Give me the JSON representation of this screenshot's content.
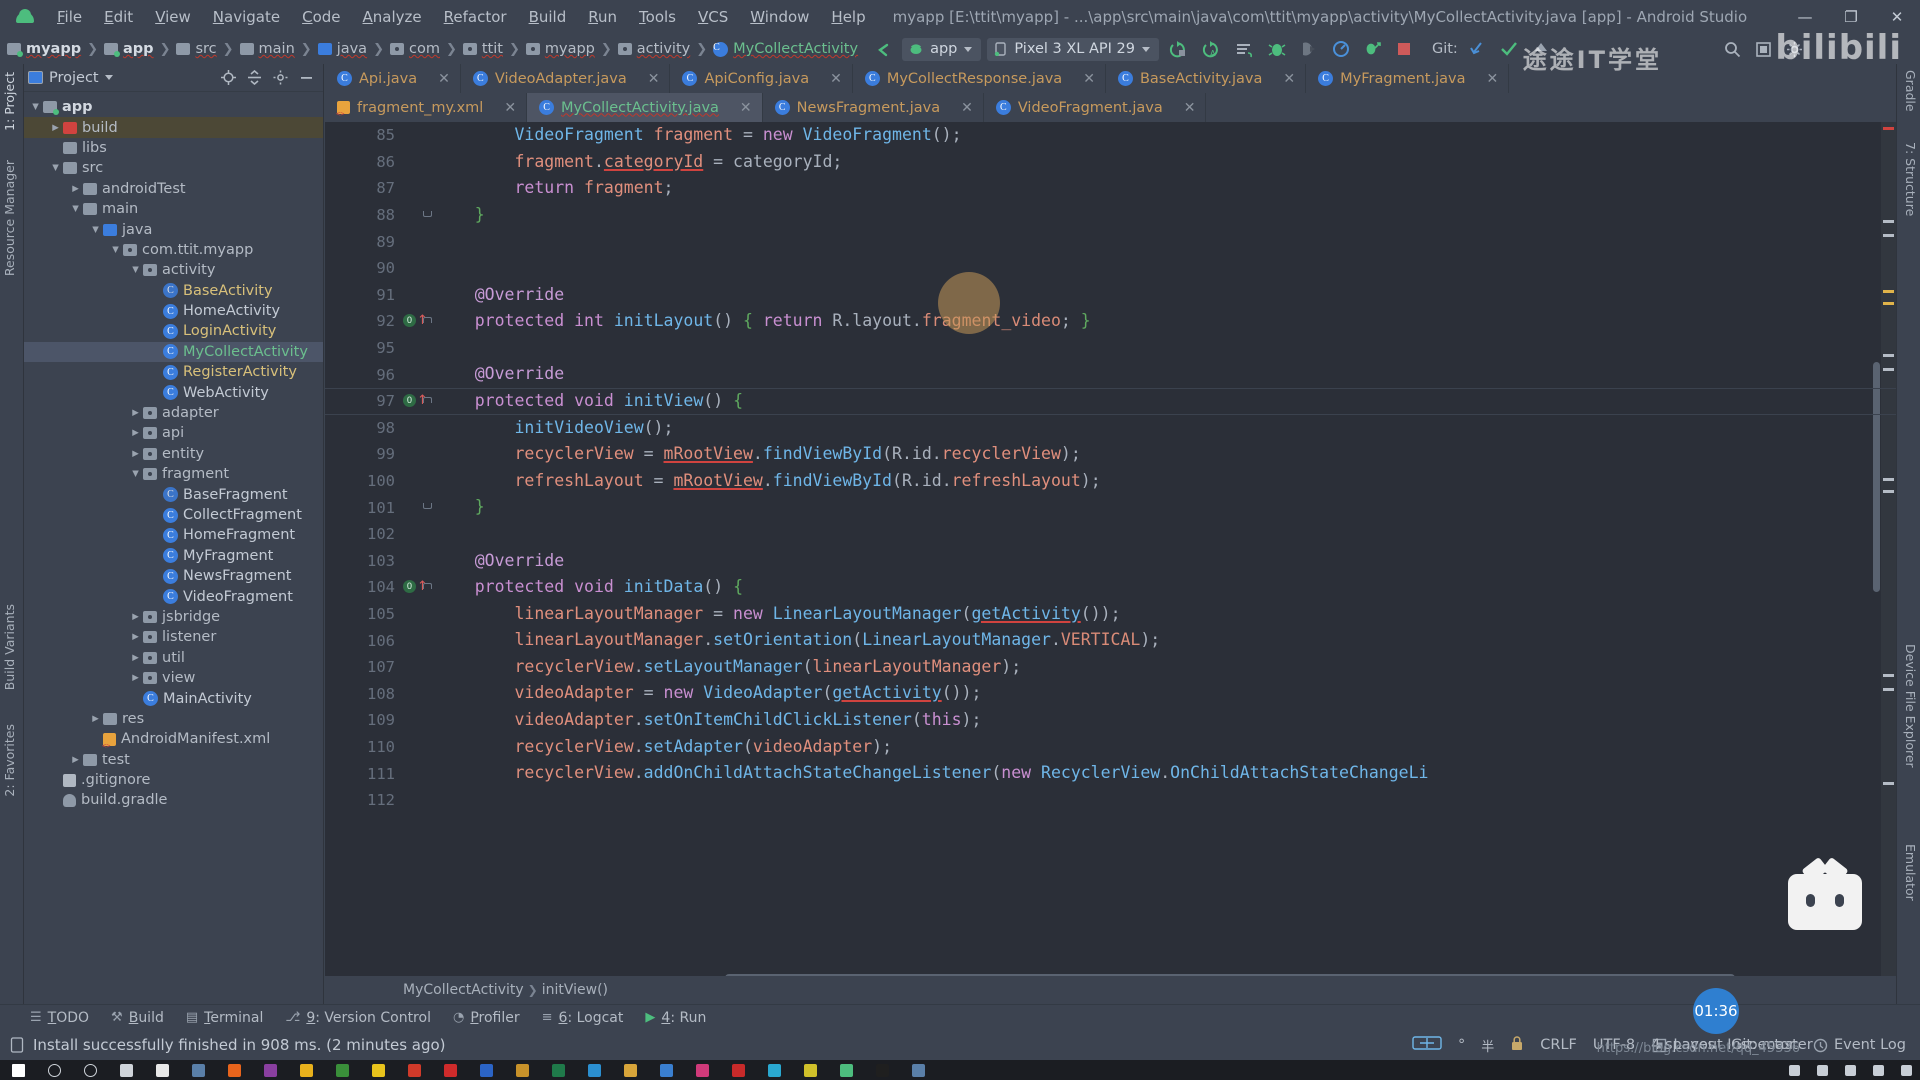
{
  "window": {
    "title": "myapp [E:\\ttit\\myapp] - ...\\app\\src\\main\\java\\com\\ttit\\myapp\\activity\\MyCollectActivity.java [app] - Android Studio",
    "minimize": "—",
    "maximize": "❐",
    "close": "✕"
  },
  "menu": [
    {
      "label": "File"
    },
    {
      "label": "Edit"
    },
    {
      "label": "View"
    },
    {
      "label": "Navigate"
    },
    {
      "label": "Code"
    },
    {
      "label": "Analyze"
    },
    {
      "label": "Refactor"
    },
    {
      "label": "Build"
    },
    {
      "label": "Run"
    },
    {
      "label": "Tools"
    },
    {
      "label": "VCS"
    },
    {
      "label": "Window"
    },
    {
      "label": "Help"
    }
  ],
  "breadcrumb": [
    {
      "label": "myapp",
      "icon": "module-icon",
      "bold": true
    },
    {
      "label": "app",
      "icon": "module-icon",
      "bold": true
    },
    {
      "label": "src",
      "icon": "folder-icon"
    },
    {
      "label": "main",
      "icon": "folder-icon"
    },
    {
      "label": "java",
      "icon": "source-folder-icon"
    },
    {
      "label": "com",
      "icon": "package-icon"
    },
    {
      "label": "ttit",
      "icon": "package-icon"
    },
    {
      "label": "myapp",
      "icon": "package-icon"
    },
    {
      "label": "activity",
      "icon": "package-icon"
    },
    {
      "label": "MyCollectActivity",
      "icon": "class-icon",
      "green": true
    }
  ],
  "toolbar": {
    "module_selector": "app",
    "device_selector": "Pixel 3 XL API 29",
    "git_label": "Git:",
    "icons": [
      "run-icon",
      "run-with-coverage-icon",
      "apply-changes-icon",
      "debug-icon",
      "attach-debugger-icon",
      "profiler-icon",
      "apply-code-changes-icon",
      "stop-icon"
    ],
    "git_icons": [
      "update-project-icon",
      "commit-icon",
      "push-icon"
    ],
    "right_icons": [
      "search-everywhere-icon",
      "settings-icon",
      "layout-inspector-icon"
    ]
  },
  "left_stripe": [
    {
      "label": "1: Project",
      "selected": true
    },
    {
      "label": "Resource Manager"
    },
    {
      "label": "Build Variants"
    },
    {
      "label": "2: Favorites"
    }
  ],
  "right_stripe": [
    {
      "label": "Gradle"
    },
    {
      "label": "7: Structure"
    },
    {
      "label": "Device File Explorer"
    },
    {
      "label": "Emulator"
    }
  ],
  "project_panel": {
    "title": "Project",
    "actions": [
      "locate-icon",
      "collapse-all-icon",
      "settings-icon",
      "hide-icon"
    ],
    "tree": [
      {
        "label": "app",
        "depth": 0,
        "arrow": "down",
        "icon": "module-icon",
        "style": "bold"
      },
      {
        "label": "build",
        "depth": 1,
        "arrow": "right",
        "icon": "folder-red-icon",
        "select": "dim"
      },
      {
        "label": "libs",
        "depth": 1,
        "arrow": "none",
        "icon": "folder-icon"
      },
      {
        "label": "src",
        "depth": 1,
        "arrow": "down",
        "icon": "folder-icon"
      },
      {
        "label": "androidTest",
        "depth": 2,
        "arrow": "right",
        "icon": "folder-icon"
      },
      {
        "label": "main",
        "depth": 2,
        "arrow": "down",
        "icon": "folder-icon"
      },
      {
        "label": "java",
        "depth": 3,
        "arrow": "down",
        "icon": "source-folder-icon"
      },
      {
        "label": "com.ttit.myapp",
        "depth": 4,
        "arrow": "down",
        "icon": "package-icon"
      },
      {
        "label": "activity",
        "depth": 5,
        "arrow": "down",
        "icon": "package-icon"
      },
      {
        "label": "BaseActivity",
        "depth": 6,
        "arrow": "none",
        "icon": "abstract-class-icon",
        "style": "yellow"
      },
      {
        "label": "HomeActivity",
        "depth": 6,
        "arrow": "none",
        "icon": "class-icon",
        "style": "white"
      },
      {
        "label": "LoginActivity",
        "depth": 6,
        "arrow": "none",
        "icon": "class-icon",
        "style": "yellow"
      },
      {
        "label": "MyCollectActivity",
        "depth": 6,
        "arrow": "none",
        "icon": "class-icon",
        "style": "green",
        "select": "blue"
      },
      {
        "label": "RegisterActivity",
        "depth": 6,
        "arrow": "none",
        "icon": "class-icon",
        "style": "yellow"
      },
      {
        "label": "WebActivity",
        "depth": 6,
        "arrow": "none",
        "icon": "class-icon",
        "style": "white"
      },
      {
        "label": "adapter",
        "depth": 5,
        "arrow": "right",
        "icon": "package-icon"
      },
      {
        "label": "api",
        "depth": 5,
        "arrow": "right",
        "icon": "package-icon"
      },
      {
        "label": "entity",
        "depth": 5,
        "arrow": "right",
        "icon": "package-icon"
      },
      {
        "label": "fragment",
        "depth": 5,
        "arrow": "down",
        "icon": "package-icon"
      },
      {
        "label": "BaseFragment",
        "depth": 6,
        "arrow": "none",
        "icon": "abstract-class-icon",
        "style": "white"
      },
      {
        "label": "CollectFragment",
        "depth": 6,
        "arrow": "none",
        "icon": "class-icon",
        "style": "white"
      },
      {
        "label": "HomeFragment",
        "depth": 6,
        "arrow": "none",
        "icon": "class-icon",
        "style": "white"
      },
      {
        "label": "MyFragment",
        "depth": 6,
        "arrow": "none",
        "icon": "class-icon",
        "style": "white"
      },
      {
        "label": "NewsFragment",
        "depth": 6,
        "arrow": "none",
        "icon": "class-icon",
        "style": "white"
      },
      {
        "label": "VideoFragment",
        "depth": 6,
        "arrow": "none",
        "icon": "class-icon",
        "style": "white"
      },
      {
        "label": "jsbridge",
        "depth": 5,
        "arrow": "right",
        "icon": "package-icon"
      },
      {
        "label": "listener",
        "depth": 5,
        "arrow": "right",
        "icon": "package-icon"
      },
      {
        "label": "util",
        "depth": 5,
        "arrow": "right",
        "icon": "package-icon"
      },
      {
        "label": "view",
        "depth": 5,
        "arrow": "right",
        "icon": "package-icon"
      },
      {
        "label": "MainActivity",
        "depth": 5,
        "arrow": "none",
        "icon": "class-icon",
        "style": "white"
      },
      {
        "label": "res",
        "depth": 3,
        "arrow": "right",
        "icon": "folder-icon"
      },
      {
        "label": "AndroidManifest.xml",
        "depth": 3,
        "arrow": "none",
        "icon": "xml-icon"
      },
      {
        "label": "test",
        "depth": 2,
        "arrow": "right",
        "icon": "folder-icon"
      },
      {
        "label": ".gitignore",
        "depth": 1,
        "arrow": "none",
        "icon": "git-icon"
      },
      {
        "label": "build.gradle",
        "depth": 1,
        "arrow": "none",
        "icon": "gradle-icon"
      }
    ]
  },
  "editor": {
    "tabs_row1": [
      {
        "label": "Api.java",
        "icon": "class-icon",
        "active": false
      },
      {
        "label": "VideoAdapter.java",
        "icon": "class-icon",
        "active": false
      },
      {
        "label": "ApiConfig.java",
        "icon": "class-icon",
        "active": false
      },
      {
        "label": "MyCollectResponse.java",
        "icon": "class-icon",
        "active": false
      },
      {
        "label": "BaseActivity.java",
        "icon": "class-icon",
        "active": false
      },
      {
        "label": "MyFragment.java",
        "icon": "class-icon",
        "active": false
      }
    ],
    "tabs_row2": [
      {
        "label": "fragment_my.xml",
        "icon": "xml-icon",
        "active": false
      },
      {
        "label": "MyCollectActivity.java",
        "icon": "class-icon",
        "active": true
      },
      {
        "label": "NewsFragment.java",
        "icon": "class-icon",
        "active": false
      },
      {
        "label": "VideoFragment.java",
        "icon": "class-icon",
        "active": false
      }
    ],
    "close_glyph": "✕",
    "first_line_number": 85,
    "line_numbers": [
      85,
      86,
      87,
      88,
      89,
      90,
      91,
      92,
      95,
      96,
      97,
      98,
      99,
      100,
      101,
      102,
      103,
      104,
      105,
      106,
      107,
      108,
      109,
      110,
      111,
      112
    ],
    "code_lines": [
      "        VideoFragment fragment = new VideoFragment();",
      "        fragment.categoryId = categoryId;",
      "        return fragment;",
      "    }",
      "",
      "",
      "    @Override",
      "    protected int initLayout() { return R.layout.fragment_video; }",
      "",
      "    @Override",
      "    protected void initView() {",
      "        initVideoView();",
      "        recyclerView = mRootView.findViewById(R.id.recyclerView);",
      "        refreshLayout = mRootView.findViewById(R.id.refreshLayout);",
      "    }",
      "",
      "    @Override",
      "    protected void initData() {",
      "        linearLayoutManager = new LinearLayoutManager(getActivity());",
      "        linearLayoutManager.setOrientation(LinearLayoutManager.VERTICAL);",
      "        recyclerView.setLayoutManager(linearLayoutManager);",
      "        videoAdapter = new VideoAdapter(getActivity());",
      "        videoAdapter.setOnItemChildClickListener(this);",
      "        recyclerView.setAdapter(videoAdapter);",
      "        recyclerView.addOnChildAttachStateChangeListener(new RecyclerView.OnChildAttachStateChangeLi",
      "        "
    ],
    "gutter_markers": [
      {
        "line": 92,
        "type": "override-marker"
      },
      {
        "line": 97,
        "type": "override-marker"
      },
      {
        "line": 104,
        "type": "override-marker"
      }
    ],
    "breadcrumbs": [
      {
        "label": "MyCollectActivity"
      },
      {
        "label": "initView()"
      }
    ]
  },
  "bottom_tools": [
    {
      "label": "TODO",
      "shortcut": "",
      "icon": "todo-icon"
    },
    {
      "label": "Build",
      "shortcut": "",
      "icon": "build-icon"
    },
    {
      "label": "Terminal",
      "shortcut": "",
      "icon": "terminal-icon"
    },
    {
      "label": "9: Version Control",
      "shortcut": "9",
      "icon": "vcs-icon"
    },
    {
      "label": "Profiler",
      "shortcut": "",
      "icon": "profiler-icon"
    },
    {
      "label": "6: Logcat",
      "shortcut": "6",
      "icon": "logcat-icon"
    },
    {
      "label": "4: Run",
      "shortcut": "4",
      "icon": "run-icon"
    }
  ],
  "statusbar": {
    "message": "Install successfully finished in 908 ms. (2 minutes ago)",
    "message_icon": "device-icon",
    "layout_inspector": "Layout Inspector",
    "event_log": "Event Log",
    "line_ending": "CRLF",
    "encoding": "UTF-8",
    "indent": "4 spaces",
    "git_branch": "Git: master",
    "lock_icon": "lock-icon"
  },
  "overlays": {
    "watermark": "bilibili",
    "watermark_cn": "途途IT学堂",
    "clock": "01:36",
    "url": "https://blog.csdn.net/qq_45336"
  },
  "taskbar": {
    "icons": [
      "windows-start-icon",
      "search-icon",
      "cortana-icon",
      "task-view-icon",
      "qq-icon",
      "calculator-icon",
      "firefox-icon",
      "onenote-icon",
      "office-icon",
      "lambda-icon",
      "notes-icon",
      "player-icon",
      "chrome-alt-icon",
      "word-icon",
      "browser-icon",
      "excel-icon",
      "edge-icon",
      "folder-icon",
      "store-icon",
      "music-icon",
      "netease-icon",
      "video-icon",
      "chrome-icon",
      "android-studio-icon",
      "terminal-icon",
      "app-icon"
    ],
    "tray": [
      "mouse-icon",
      "monitor-icon",
      "network-icon",
      "volume-icon",
      "ime-icon"
    ]
  },
  "colors": {
    "accent_green": "#6bbf8e",
    "tab_active_bg": "#4e5564",
    "panel_bg": "#3c4350",
    "editor_bg": "#2b2f38",
    "selection_blue": "#4c5568",
    "error_red": "#d0433f"
  }
}
